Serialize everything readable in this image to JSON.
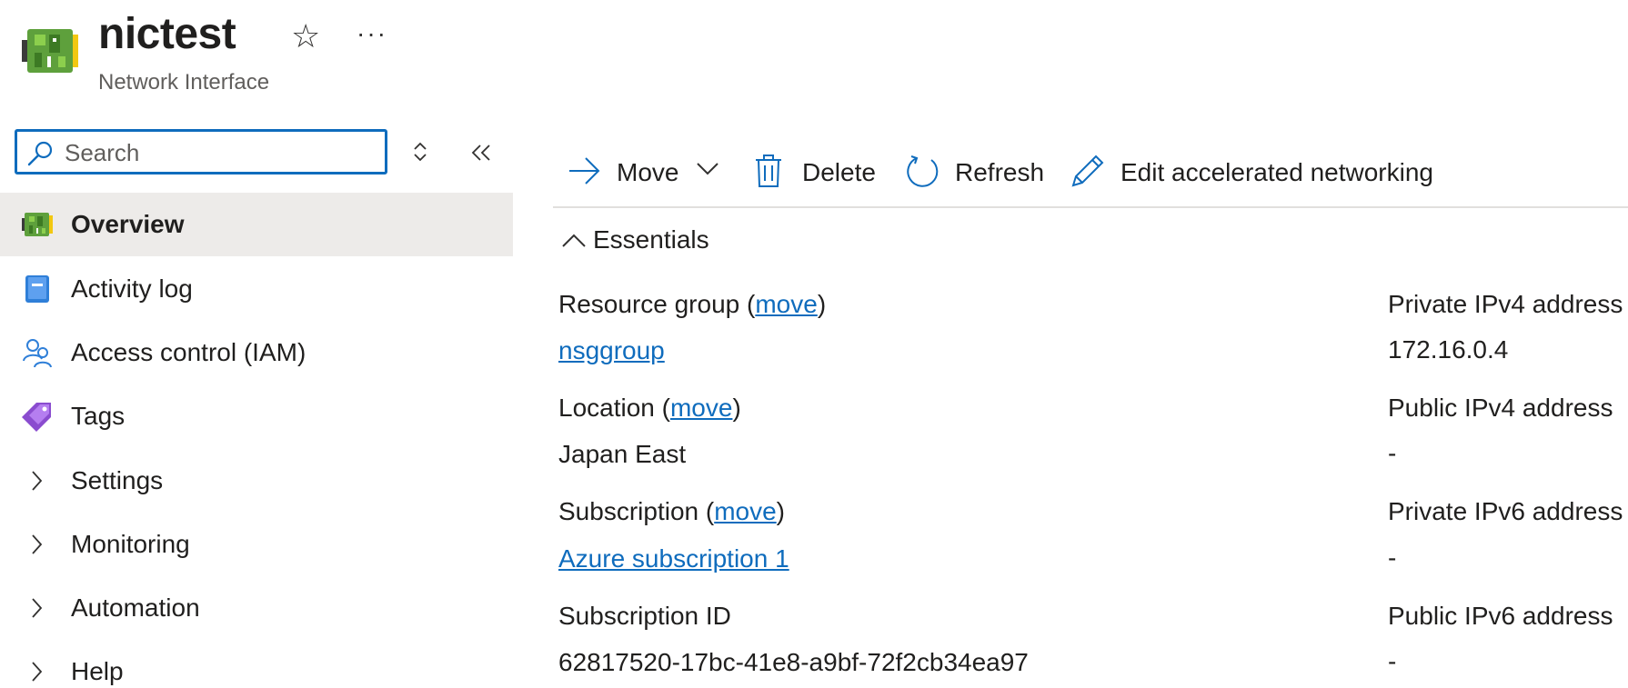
{
  "header": {
    "title": "nictest",
    "subtitle": "Network Interface",
    "more_label": "···"
  },
  "search": {
    "placeholder": "Search",
    "value": ""
  },
  "sidebar": {
    "items": [
      {
        "label": "Overview",
        "icon": "network-interface-icon",
        "active": true
      },
      {
        "label": "Activity log",
        "icon": "activity-log-icon"
      },
      {
        "label": "Access control (IAM)",
        "icon": "iam-people-icon"
      },
      {
        "label": "Tags",
        "icon": "tag-icon"
      },
      {
        "label": "Settings",
        "icon": "chevron-right-icon",
        "expandable": true
      },
      {
        "label": "Monitoring",
        "icon": "chevron-right-icon",
        "expandable": true
      },
      {
        "label": "Automation",
        "icon": "chevron-right-icon",
        "expandable": true
      },
      {
        "label": "Help",
        "icon": "chevron-right-icon",
        "expandable": true
      }
    ]
  },
  "toolbar": {
    "move_label": "Move",
    "delete_label": "Delete",
    "refresh_label": "Refresh",
    "edit_label": "Edit accelerated networking"
  },
  "essentials": {
    "toggle_label": "Essentials",
    "left": [
      {
        "label": "Resource group (",
        "link": "move",
        "suffix": ")",
        "value": "nsggroup",
        "value_is_link": true
      },
      {
        "label": "Location (",
        "link": "move",
        "suffix": ")",
        "value": "Japan East",
        "value_is_link": false
      },
      {
        "label": "Subscription (",
        "link": "move",
        "suffix": ")",
        "value": "Azure subscription 1",
        "value_is_link": true
      },
      {
        "label": "Subscription ID",
        "link": "",
        "suffix": "",
        "value": "62817520-17bc-41e8-a9bf-72f2cb34ea97",
        "value_is_link": false
      }
    ],
    "right": [
      {
        "label": "Private IPv4 address",
        "value": "172.16.0.4"
      },
      {
        "label": "Public IPv4 address",
        "value": "-"
      },
      {
        "label": "Private IPv6 address",
        "value": "-"
      },
      {
        "label": "Public IPv6 address",
        "value": "-"
      }
    ]
  },
  "colors": {
    "accent": "#0f6cbd",
    "active_bg": "#edebe9",
    "divider": "#e1dfdd",
    "text": "#201f1e"
  }
}
